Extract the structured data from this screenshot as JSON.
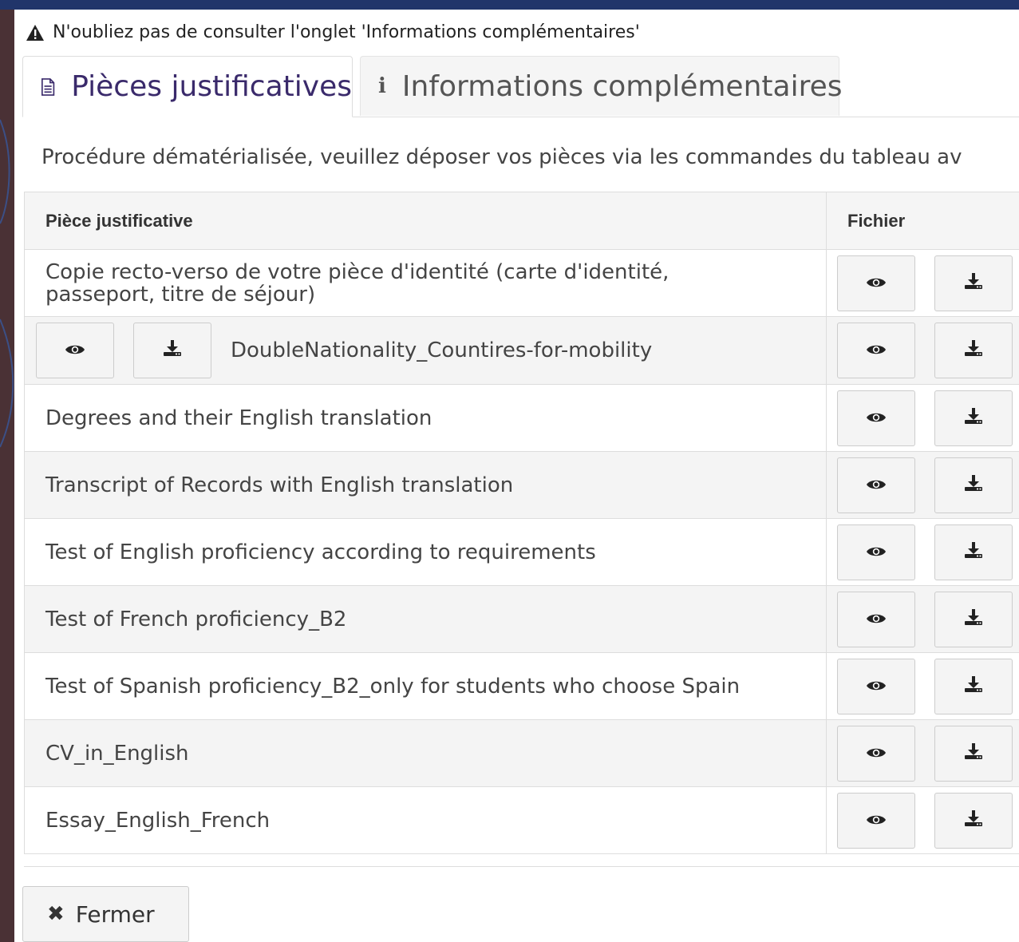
{
  "warning": {
    "icon": "warning-icon",
    "text": "N'oubliez pas de consulter l'onglet 'Informations complémentaires'"
  },
  "tabs": [
    {
      "label": "Pièces justificatives",
      "icon": "document-icon",
      "active": true
    },
    {
      "label": "Informations complémentaires",
      "icon": "info-icon",
      "active": false
    }
  ],
  "intro": "Procédure dématérialisée, veuillez déposer vos pièces via les commandes du tableau av",
  "table": {
    "headers": [
      "Pièce justificative",
      "Fichier"
    ],
    "rows": [
      {
        "name": "Copie recto-verso de votre pièce d'identité (carte d'identité, passeport, titre de séjour)"
      },
      {
        "name": "DoubleNationality_Countires-for-mobility",
        "inline_buttons": true
      },
      {
        "name": "Degrees and their English translation"
      },
      {
        "name": "Transcript of Records with English translation"
      },
      {
        "name": "Test of English proficiency according to requirements"
      },
      {
        "name": "Test of French proficiency_B2"
      },
      {
        "name": "Test of Spanish proficiency_B2_only for students who choose Spain"
      },
      {
        "name": "CV_in_English"
      },
      {
        "name": "Essay_English_French"
      }
    ]
  },
  "close_button": {
    "icon": "close-icon",
    "label": "Fermer"
  },
  "colors": {
    "tab_active": "#3a2a6b",
    "background": "#4a3135",
    "top_band": "#21356a"
  }
}
